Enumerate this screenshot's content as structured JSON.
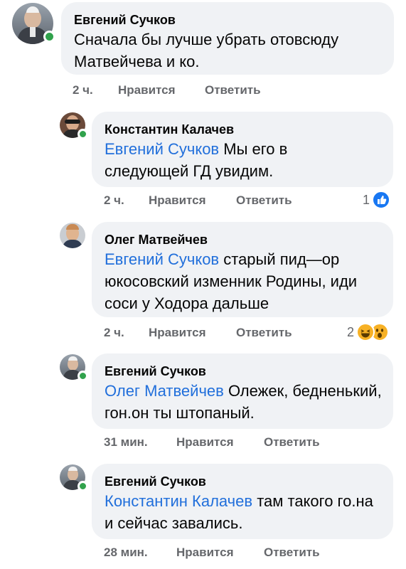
{
  "comments": [
    {
      "author": "Евгений Сучков",
      "mention": "",
      "text": "Сначала бы лучше убрать отовсюду Матвейчева и ко.",
      "time": "2 ч.",
      "like_label": "Нравится",
      "reply_label": "Ответить",
      "reaction_count": "",
      "online": true
    },
    {
      "author": "Константин Калачев",
      "mention": "Евгений Сучков",
      "text": " Мы его в следующей ГД увидим.",
      "time": "2 ч.",
      "like_label": "Нравится",
      "reply_label": "Ответить",
      "reaction_count": "1",
      "reaction_icons": [
        "like-icon"
      ],
      "online": true
    },
    {
      "author": "Олег Матвейчев",
      "mention": "Евгений Сучков",
      "text": " старый пид—ор юкосовский  изменник Родины, иди соси у Ходора дальше",
      "time": "2 ч.",
      "like_label": "Нравится",
      "reply_label": "Ответить",
      "reaction_count": "2",
      "reaction_icons": [
        "haha-icon",
        "wow-icon"
      ],
      "online": false
    },
    {
      "author": "Евгений Сучков",
      "mention": "Олег Матвейчев",
      "text": " Олежек, бедненький, гон.он ты штопаный.",
      "time": "31 мин.",
      "like_label": "Нравится",
      "reply_label": "Ответить",
      "reaction_count": "",
      "online": true
    },
    {
      "author": "Евгений Сучков",
      "mention": "Константин Калачев",
      "text": " там такого го.на и сейчас завались.",
      "time": "28 мин.",
      "like_label": "Нравится",
      "reply_label": "Ответить",
      "reaction_count": "",
      "online": true
    }
  ],
  "colors": {
    "bubble": "#f0f2f5",
    "mention": "#216fdb",
    "meta": "#65676b",
    "online": "#31a24c",
    "like": "#1877f2",
    "emoji": "#f7b125"
  }
}
